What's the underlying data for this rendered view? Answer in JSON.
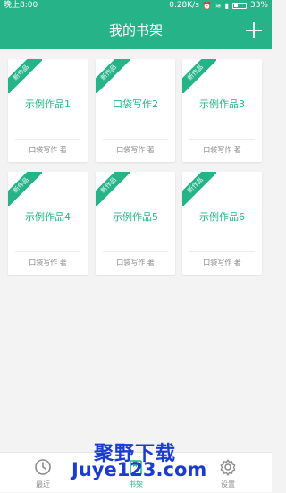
{
  "status_bar": {
    "time": "晚上8:00",
    "net_speed": "0.28K/s",
    "battery": "33%"
  },
  "app_bar": {
    "title": "我的书架"
  },
  "books": [
    {
      "badge": "新作品",
      "title": "示例作品1",
      "author": "口袋写作 著"
    },
    {
      "badge": "新作品",
      "title": "口袋写作2",
      "author": "口袋写作 著"
    },
    {
      "badge": "新作品",
      "title": "示例作品3",
      "author": "口袋写作 著"
    },
    {
      "badge": "新作品",
      "title": "示例作品4",
      "author": "口袋写作 著"
    },
    {
      "badge": "新作品",
      "title": "示例作品5",
      "author": "口袋写作 著"
    },
    {
      "badge": "新作品",
      "title": "示例作品6",
      "author": "口袋写作 著"
    }
  ],
  "bottom_nav": [
    {
      "label": "最近",
      "icon": "clock-icon",
      "active": false
    },
    {
      "label": "书架",
      "icon": "bookshelf-icon",
      "active": true
    },
    {
      "label": "设置",
      "icon": "gear-icon",
      "active": false
    }
  ],
  "watermark": {
    "line1": "聚野下载",
    "line2": "Juye123.com"
  },
  "colors": {
    "accent": "#26b387",
    "background": "#f3f3f3"
  }
}
